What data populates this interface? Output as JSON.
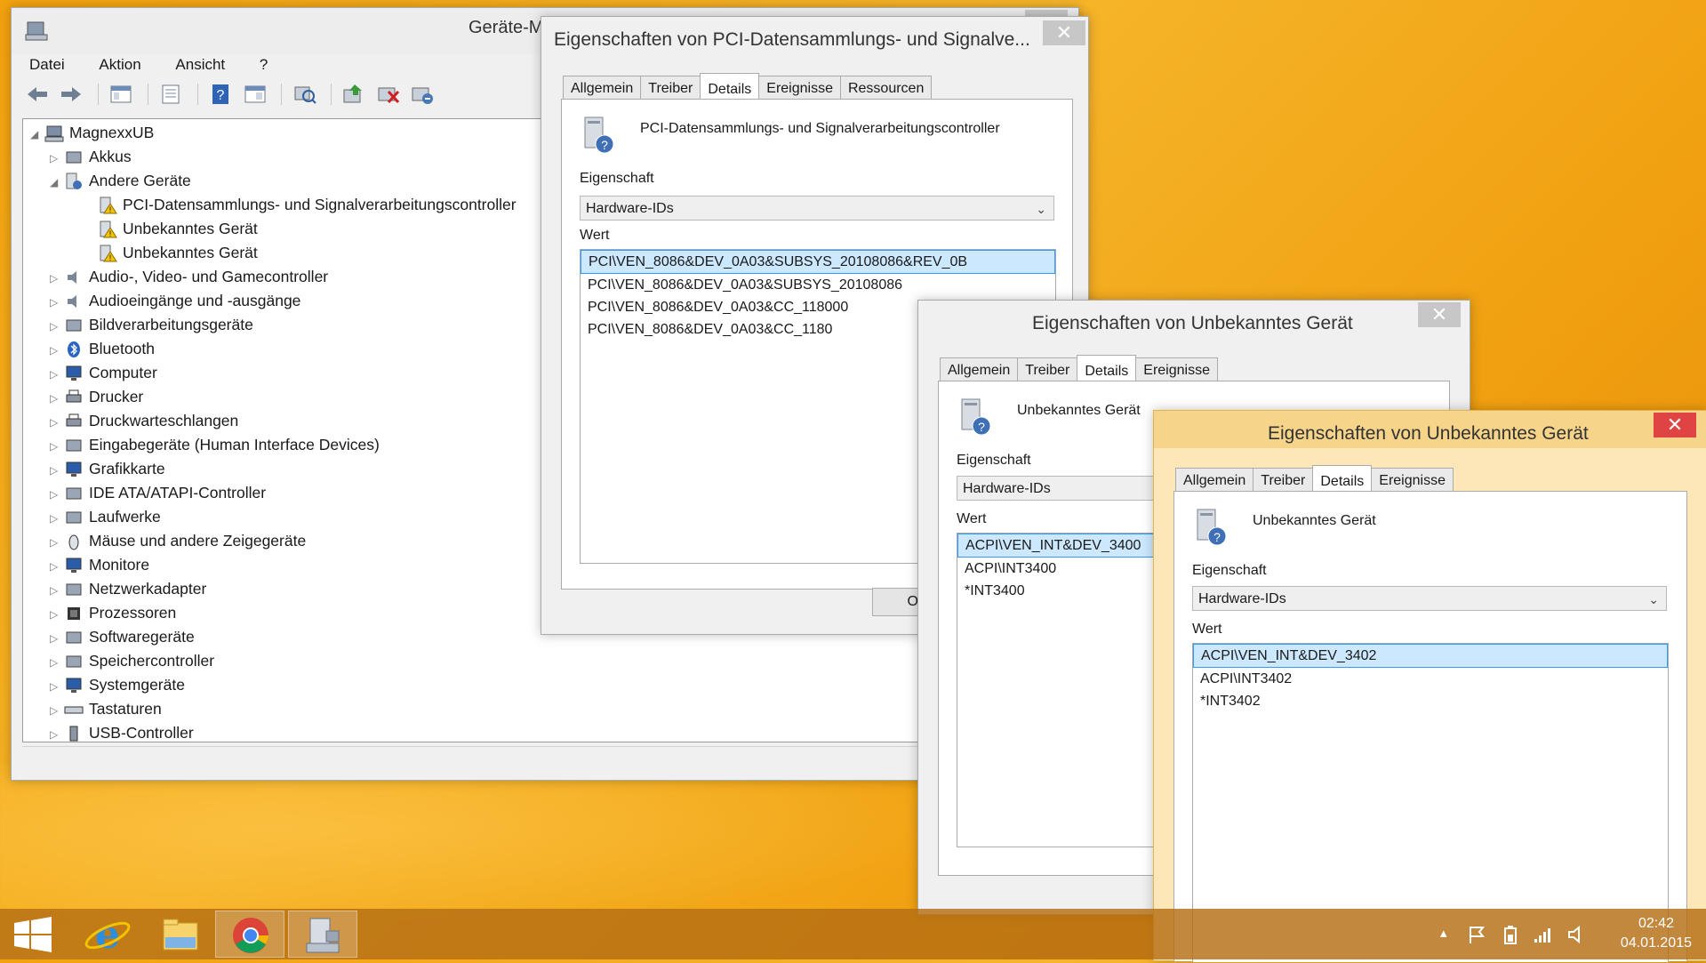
{
  "device_manager": {
    "title": "Geräte-M",
    "menu": [
      "Datei",
      "Aktion",
      "Ansicht",
      "?"
    ],
    "toolbar_icons": [
      "back-arrow-icon",
      "forward-arrow-icon",
      "show-hide-tree-icon",
      "properties-icon",
      "help-icon",
      "view-icon",
      "scan-hardware-icon",
      "update-driver-icon",
      "uninstall-icon",
      "enable-device-icon"
    ],
    "tree": {
      "root": "MagnexxUB",
      "items": [
        {
          "label": "Akkus",
          "icon": "battery-icon",
          "expanded": false,
          "level": 1
        },
        {
          "label": "Andere Geräte",
          "icon": "unknown-device-icon",
          "expanded": true,
          "level": 1
        },
        {
          "label": "PCI-Datensammlungs- und Signalverarbeitungscontroller",
          "icon": "warning-device-icon",
          "level": 2
        },
        {
          "label": "Unbekanntes Gerät",
          "icon": "warning-device-icon",
          "level": 2
        },
        {
          "label": "Unbekanntes Gerät",
          "icon": "warning-device-icon",
          "level": 2
        },
        {
          "label": "Audio-, Video- und Gamecontroller",
          "icon": "speaker-icon",
          "expanded": false,
          "level": 1
        },
        {
          "label": "Audioeingänge und -ausgänge",
          "icon": "speaker-icon",
          "expanded": false,
          "level": 1
        },
        {
          "label": "Bildverarbeitungsgeräte",
          "icon": "camera-icon",
          "expanded": false,
          "level": 1
        },
        {
          "label": "Bluetooth",
          "icon": "bluetooth-icon",
          "expanded": false,
          "level": 1
        },
        {
          "label": "Computer",
          "icon": "computer-icon",
          "expanded": false,
          "level": 1
        },
        {
          "label": "Drucker",
          "icon": "printer-icon",
          "expanded": false,
          "level": 1
        },
        {
          "label": "Druckwarteschlangen",
          "icon": "printer-icon",
          "expanded": false,
          "level": 1
        },
        {
          "label": "Eingabegeräte (Human Interface Devices)",
          "icon": "hid-icon",
          "expanded": false,
          "level": 1
        },
        {
          "label": "Grafikkarte",
          "icon": "display-adapter-icon",
          "expanded": false,
          "level": 1
        },
        {
          "label": "IDE ATA/ATAPI-Controller",
          "icon": "ide-controller-icon",
          "expanded": false,
          "level": 1
        },
        {
          "label": "Laufwerke",
          "icon": "disk-drive-icon",
          "expanded": false,
          "level": 1
        },
        {
          "label": "Mäuse und andere Zeigegeräte",
          "icon": "mouse-icon",
          "expanded": false,
          "level": 1
        },
        {
          "label": "Monitore",
          "icon": "monitor-icon",
          "expanded": false,
          "level": 1
        },
        {
          "label": "Netzwerkadapter",
          "icon": "network-adapter-icon",
          "expanded": false,
          "level": 1
        },
        {
          "label": "Prozessoren",
          "icon": "processor-icon",
          "expanded": false,
          "level": 1
        },
        {
          "label": "Softwaregeräte",
          "icon": "software-device-icon",
          "expanded": false,
          "level": 1
        },
        {
          "label": "Speichercontroller",
          "icon": "storage-controller-icon",
          "expanded": false,
          "level": 1
        },
        {
          "label": "Systemgeräte",
          "icon": "system-device-icon",
          "expanded": false,
          "level": 1
        },
        {
          "label": "Tastaturen",
          "icon": "keyboard-icon",
          "expanded": false,
          "level": 1
        },
        {
          "label": "USB-Controller",
          "icon": "usb-icon",
          "expanded": false,
          "level": 1
        }
      ]
    }
  },
  "dialog_pci": {
    "title": "Eigenschaften von PCI-Datensammlungs- und Signalve...",
    "tabs": [
      "Allgemein",
      "Treiber",
      "Details",
      "Ereignisse",
      "Ressourcen"
    ],
    "selected_tab": "Details",
    "device_name": "PCI-Datensammlungs- und Signalverarbeitungscontroller",
    "property_label": "Eigenschaft",
    "property_value": "Hardware-IDs",
    "value_label": "Wert",
    "values": [
      "PCI\\VEN_8086&DEV_0A03&SUBSYS_20108086&REV_0B",
      "PCI\\VEN_8086&DEV_0A03&SUBSYS_20108086",
      "PCI\\VEN_8086&DEV_0A03&CC_118000",
      "PCI\\VEN_8086&DEV_0A03&CC_1180"
    ],
    "ok_label": "OK"
  },
  "dialog_unknown1": {
    "title": "Eigenschaften von Unbekanntes Gerät",
    "tabs": [
      "Allgemein",
      "Treiber",
      "Details",
      "Ereignisse"
    ],
    "selected_tab": "Details",
    "device_name": "Unbekanntes Gerät",
    "property_label": "Eigenschaft",
    "property_value": "Hardware-IDs",
    "value_label": "Wert",
    "values": [
      "ACPI\\VEN_INT&DEV_3400",
      "ACPI\\INT3400",
      "*INT3400"
    ]
  },
  "dialog_unknown2": {
    "title": "Eigenschaften von Unbekanntes Gerät",
    "tabs": [
      "Allgemein",
      "Treiber",
      "Details",
      "Ereignisse"
    ],
    "selected_tab": "Details",
    "device_name": "Unbekanntes Gerät",
    "property_label": "Eigenschaft",
    "property_value": "Hardware-IDs",
    "value_label": "Wert",
    "values": [
      "ACPI\\VEN_INT&DEV_3402",
      "ACPI\\INT3402",
      "*INT3402"
    ]
  },
  "taskbar": {
    "apps": [
      "start-icon",
      "internet-explorer-icon",
      "file-explorer-icon",
      "chrome-icon",
      "device-manager-icon"
    ],
    "tray_icons": [
      "show-hidden-icons-chevron",
      "action-center-flag-icon",
      "power-icon",
      "network-signal-icon",
      "volume-icon"
    ],
    "time": "02:42",
    "date": "04.01.2015"
  },
  "colors": {
    "desktop": "#f2a20e",
    "active_close": "#e04343",
    "selection": "#cce8ff",
    "active_dialog_frame": "#f6d48a"
  }
}
